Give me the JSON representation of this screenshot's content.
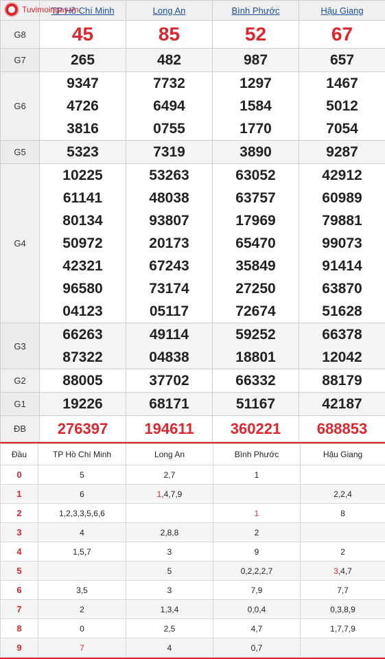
{
  "logo": {
    "text": "Tuvimoingay.vn"
  },
  "provinces": [
    "TP Hồ Chí Minh",
    "Long An",
    "Bình Phước",
    "Hậu Giang"
  ],
  "prizes": [
    {
      "label": "G8",
      "values": [
        [
          "45"
        ],
        [
          "85"
        ],
        [
          "52"
        ],
        [
          "67"
        ]
      ]
    },
    {
      "label": "G7",
      "values": [
        [
          "265"
        ],
        [
          "482"
        ],
        [
          "987"
        ],
        [
          "657"
        ]
      ]
    },
    {
      "label": "G6",
      "values": [
        [
          "9347",
          "4726",
          "3816"
        ],
        [
          "7732",
          "6494",
          "0755"
        ],
        [
          "1297",
          "1584",
          "1770"
        ],
        [
          "1467",
          "5012",
          "7054"
        ]
      ]
    },
    {
      "label": "G5",
      "values": [
        [
          "5323"
        ],
        [
          "7319"
        ],
        [
          "3890"
        ],
        [
          "9287"
        ]
      ]
    },
    {
      "label": "G4",
      "values": [
        [
          "10225",
          "61141",
          "80134",
          "50972",
          "42321",
          "96580",
          "04123"
        ],
        [
          "53263",
          "48038",
          "93807",
          "20173",
          "67243",
          "73174",
          "05117"
        ],
        [
          "63052",
          "63757",
          "17969",
          "65470",
          "35849",
          "27250",
          "72674"
        ],
        [
          "42912",
          "60989",
          "79881",
          "99073",
          "91414",
          "63870",
          "51628"
        ]
      ]
    },
    {
      "label": "G3",
      "values": [
        [
          "66263",
          "87322"
        ],
        [
          "49114",
          "04838"
        ],
        [
          "59252",
          "18801"
        ],
        [
          "66378",
          "12042"
        ]
      ]
    },
    {
      "label": "G2",
      "values": [
        [
          "88005"
        ],
        [
          "37702"
        ],
        [
          "66332"
        ],
        [
          "88179"
        ]
      ]
    },
    {
      "label": "G1",
      "values": [
        [
          "19226"
        ],
        [
          "68171"
        ],
        [
          "51167"
        ],
        [
          "42187"
        ]
      ]
    },
    {
      "label": "ĐB",
      "values": [
        [
          "276397"
        ],
        [
          "194611"
        ],
        [
          "360221"
        ],
        [
          "688853"
        ]
      ]
    }
  ],
  "loto": {
    "header": [
      "Đầu",
      "TP Hồ Chí Minh",
      "Long An",
      "Bình Phước",
      "Hậu Giang"
    ],
    "rows": [
      {
        "dau": "0",
        "cells": [
          {
            "t": "5"
          },
          {
            "t": "2,7"
          },
          {
            "t": "1"
          },
          {
            "t": ""
          }
        ]
      },
      {
        "dau": "1",
        "cells": [
          {
            "t": "6"
          },
          {
            "red": "1",
            "t": ",4,7,9"
          },
          {
            "t": ""
          },
          {
            "t": "2,2,4"
          }
        ]
      },
      {
        "dau": "2",
        "cells": [
          {
            "t": "1,2,3,3,5,6,6"
          },
          {
            "t": ""
          },
          {
            "red": "1",
            "t": ""
          },
          {
            "t": "8"
          }
        ]
      },
      {
        "dau": "3",
        "cells": [
          {
            "t": "4"
          },
          {
            "t": "2,8,8"
          },
          {
            "t": "2"
          },
          {
            "t": ""
          }
        ]
      },
      {
        "dau": "4",
        "cells": [
          {
            "t": "1,5,7"
          },
          {
            "t": "3"
          },
          {
            "t": "9"
          },
          {
            "t": "2"
          }
        ]
      },
      {
        "dau": "5",
        "cells": [
          {
            "t": ""
          },
          {
            "t": "5"
          },
          {
            "t": "0,2,2,2,7"
          },
          {
            "red": "3",
            "t": ",4,7"
          }
        ]
      },
      {
        "dau": "6",
        "cells": [
          {
            "t": "3,5"
          },
          {
            "t": "3"
          },
          {
            "t": "7,9"
          },
          {
            "t": "7,7"
          }
        ]
      },
      {
        "dau": "7",
        "cells": [
          {
            "t": "2"
          },
          {
            "t": "1,3,4"
          },
          {
            "t": "0,0,4"
          },
          {
            "t": "0,3,8,9"
          }
        ]
      },
      {
        "dau": "8",
        "cells": [
          {
            "t": "0"
          },
          {
            "t": "2,5"
          },
          {
            "t": "4,7"
          },
          {
            "t": "1,7,7,9"
          }
        ]
      },
      {
        "dau": "9",
        "cells": [
          {
            "red": "7",
            "t": ""
          },
          {
            "t": "4"
          },
          {
            "t": "0,7"
          },
          {
            "t": ""
          }
        ]
      }
    ]
  },
  "colors": {
    "accent": "#e0262d",
    "link": "#1a4fa0",
    "header_bg": "#f0f0f0"
  }
}
